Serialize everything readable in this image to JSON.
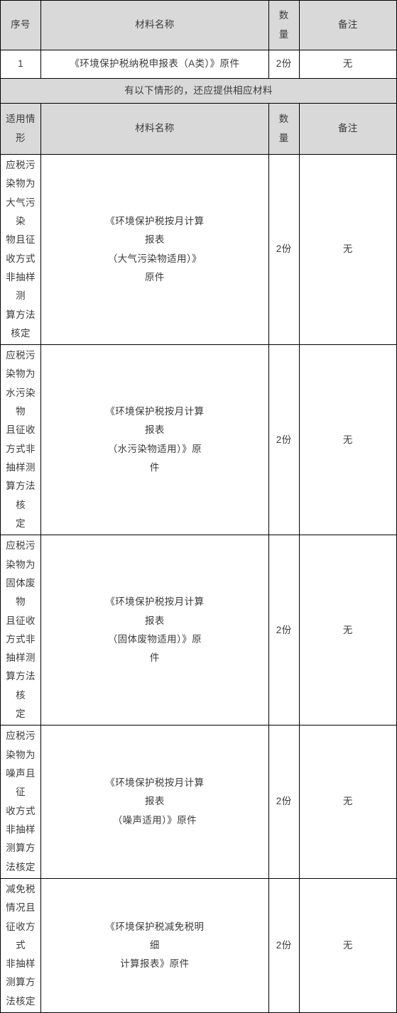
{
  "table": {
    "header_primary": {
      "seq": "序号",
      "material_name": "材料名称",
      "quantity": "数\n量",
      "remark": "备注"
    },
    "rows_primary": [
      {
        "seq": "1",
        "material_name": "《环境保护税纳税申报表（A类）》原件",
        "quantity": "2份",
        "remark": "无"
      }
    ],
    "band_note": "有以下情形的，还应提供相应材料",
    "header_secondary": {
      "applicable_case": "适用情形",
      "material_name": "材料名称",
      "quantity": "数\n量",
      "remark": "备注"
    },
    "rows_secondary": [
      {
        "applicable_case": "应税污染物为大气污染\n物且征收方式非抽样测\n算方法核定",
        "material_name": "《环境保护税按月计算\n报表\n（大气污染物适用）》\n原件",
        "quantity": "2份",
        "remark": "无"
      },
      {
        "applicable_case": "应税污染物为水污染物\n且征收\n方式非抽样测算方法核\n定",
        "material_name": "《环境保护税按月计算\n报表\n（水污染物适用）》原\n件",
        "quantity": "2份",
        "remark": "无"
      },
      {
        "applicable_case": "应税污染物为固体废物\n且征收\n方式非抽样测算方法核\n定",
        "material_name": "《环境保护税按月计算\n报表\n（固体废物适用）》原\n件",
        "quantity": "2份",
        "remark": "无"
      },
      {
        "applicable_case": "应税污染物为噪声且征\n收方式\n非抽样测算方法核定",
        "material_name": "《环境保护税按月计算\n报表\n（噪声适用）》原件",
        "quantity": "2份",
        "remark": "无"
      },
      {
        "applicable_case": "减免税情况且征收方式\n非抽样\n测算方法核定",
        "material_name": "《环境保护税减免税明\n细\n计算报表》原件",
        "quantity": "2份",
        "remark": "无"
      }
    ]
  },
  "colors": {
    "header_background": "#d9d9d9",
    "body_background": "#ffffff",
    "border": "#000000",
    "text": "#3b3b3b"
  }
}
